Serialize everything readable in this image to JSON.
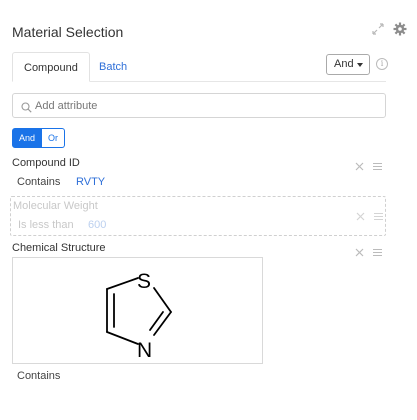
{
  "panel": {
    "title": "Material Selection"
  },
  "tabs": [
    {
      "label": "Compound",
      "active": true
    },
    {
      "label": "Batch",
      "active": false
    }
  ],
  "combinator_select": {
    "value": "And"
  },
  "search": {
    "placeholder": "Add attribute",
    "value": ""
  },
  "logic_toggle": {
    "and_label": "And",
    "or_label": "Or",
    "selected": "And"
  },
  "criteria": [
    {
      "name": "Compound ID",
      "operator": "Contains",
      "value": "RVTY"
    },
    {
      "name": "Molecular Weight",
      "operator": "Is less than",
      "value": "600",
      "state": "dragging-ghost"
    },
    {
      "name": "Chemical Structure",
      "operator": "Contains",
      "structure": "thiazole",
      "atoms": [
        "S",
        "N"
      ]
    }
  ],
  "colors": {
    "accent": "#1a73e8",
    "link": "#2e6fd8",
    "border": "#d9d9d9"
  },
  "icons": [
    "expand-icon",
    "gear-icon",
    "info-icon",
    "search-icon",
    "close-icon",
    "menu-icon",
    "caret-down-icon"
  ]
}
